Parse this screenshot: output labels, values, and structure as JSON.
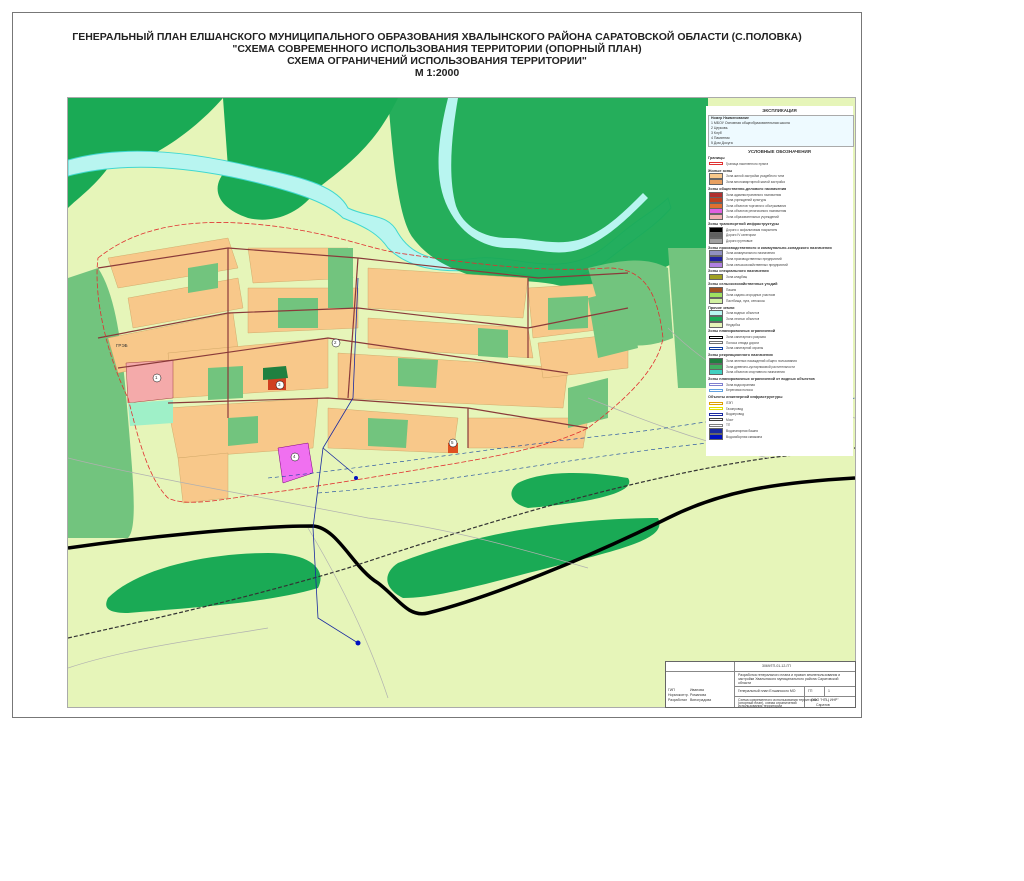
{
  "title": {
    "line1": "ГЕНЕРАЛЬНЫЙ ПЛАН ЕЛШАНСКОГО МУНИЦИПАЛЬНОГО ОБРАЗОВАНИЯ  ХВАЛЫНСКОГО РАЙОНА САРАТОВСКОЙ ОБЛАСТИ (С.ПОЛОВКА)",
    "line2": "\"СХЕМА СОВРЕМЕННОГО ИСПОЛЬЗОВАНИЯ ТЕРРИТОРИИ (ОПОРНЫЙ ПЛАН)",
    "line3": "СХЕМА ОГРАНИЧЕНИЙ ИСПОЛЬЗОВАНИЯ ТЕРРИТОРИИ\"",
    "line4": "М 1:2000"
  },
  "colors": {
    "background": "#e6f5b9",
    "forest": "#1aaa55",
    "green_area": "#72c47e",
    "residential": "#f8c88a",
    "river": "#b8f5f0",
    "road_main": "#000000",
    "road_street": "#8a3a3a",
    "utility": "#1a2aa0",
    "boundary": "#e03030"
  },
  "map": {
    "place_label": "ГРЭБ",
    "markers": [
      "1",
      "2",
      "3",
      "4",
      "5"
    ]
  },
  "legend": {
    "explication_title": "ЭКСПЛИКАЦИЯ",
    "explication_header": "Номер   Наименование",
    "explication_rows": [
      "1  МБОУ Основная общеобразовательная школа",
      "2  Церковь",
      "3  Клуб",
      "4  Памятник",
      "5  Дом Досуга"
    ],
    "symbols_title": "УСЛОВНЫЕ ОБОЗНАЧЕНИЯ",
    "sections": [
      {
        "name": "Границы",
        "items": [
          {
            "label": "Граница населенного пункта",
            "color": "#ffffff",
            "line": "#e03030"
          }
        ]
      },
      {
        "name": "Жилые зоны",
        "items": [
          {
            "label": "Зона жилой застройки усадебного типа",
            "color": "#f8c88a"
          },
          {
            "label": "Зона многоквартирной жилой застройки",
            "color": "#e8a060"
          }
        ]
      },
      {
        "name": "Зоны общественно-делового назначения",
        "items": [
          {
            "label": "Зона административного назначения",
            "color": "#b03030"
          },
          {
            "label": "Зона учреждений культуры",
            "color": "#c04020"
          },
          {
            "label": "Зона объектов торговли и обслуживания",
            "color": "#e07030"
          },
          {
            "label": "Зона объектов религиозного назначения",
            "color": "#e060e0"
          },
          {
            "label": "Зона образовательных учреждений",
            "color": "#f0b0b0"
          }
        ]
      },
      {
        "name": "Зоны транспортной инфраструктуры",
        "items": [
          {
            "label": "Дороги с асфальтовым покрытием",
            "color": "#000000"
          },
          {
            "label": "Дороги IV категории",
            "color": "#606060"
          },
          {
            "label": "Дороги грунтовые",
            "color": "#a0a0a0"
          }
        ]
      },
      {
        "name": "Зоны производственного и коммунально-складского назначения",
        "items": [
          {
            "label": "Зона коммунального назначения",
            "color": "#9090c0"
          },
          {
            "label": "Зона производственных предприятий",
            "color": "#2020a0"
          },
          {
            "label": "Зона сельскохозяйственных предприятий",
            "color": "#b080e0"
          }
        ]
      },
      {
        "name": "Зоны специального назначения",
        "items": [
          {
            "label": "Зона кладбищ",
            "color": "#a0a020"
          }
        ]
      },
      {
        "name": "Зоны сельскохозяйственных угодий",
        "items": [
          {
            "label": "Пашня",
            "color": "#a05020"
          },
          {
            "label": "Зона садово-огородных участков",
            "color": "#a0e060"
          },
          {
            "label": "Пастбища, луга, сенокосы",
            "color": "#d0f0a0"
          }
        ]
      },
      {
        "name": "Прочие земли",
        "items": [
          {
            "label": "Зона водных объектов",
            "color": "#b8f5f0"
          },
          {
            "label": "Зона лесных объектов",
            "color": "#1aaa55"
          },
          {
            "label": "Неудобья",
            "color": "#e6f5b9"
          }
        ]
      },
      {
        "name": "Зоны планировочных ограничений",
        "items": [
          {
            "label": "Зона санитарного разрыва",
            "color": "#ffffff",
            "line": "#000000"
          },
          {
            "label": "Полоса отвода дороги",
            "color": "#ffffff",
            "line": "#707070"
          },
          {
            "label": "Зона санитарной охраны",
            "color": "#ffffff",
            "line": "#1040a0"
          }
        ]
      },
      {
        "name": "Зоны рекреационного назначения",
        "items": [
          {
            "label": "Зона зеленых насаждений общего пользования",
            "color": "#208040"
          },
          {
            "label": "Зона древесно-кустарниковой растительности",
            "color": "#40b060"
          },
          {
            "label": "Зона объектов спортивного назначения",
            "color": "#40d0c0"
          }
        ]
      },
      {
        "name": "Зоны планировочных ограничений от водных объектов",
        "items": [
          {
            "label": "Зона водоохранная",
            "color": "#ffffff",
            "line": "#8080d0"
          },
          {
            "label": "Береговая полоса",
            "color": "#ffffff",
            "line": "#60a0e0"
          }
        ]
      },
      {
        "name": "Объекты инженерной инфраструктуры",
        "items": [
          {
            "label": "ЛЭП",
            "color": "#ffffff",
            "line": "#e0a000"
          },
          {
            "label": "Газопровод",
            "color": "#ffffff",
            "line": "#e0e000"
          },
          {
            "label": "Водопровод",
            "color": "#ffffff",
            "line": "#1a2aa0"
          },
          {
            "label": "Мост",
            "color": "#ffffff",
            "line": "#404040"
          },
          {
            "label": "ТП",
            "color": "#ffffff",
            "line": "#808080"
          },
          {
            "label": "Водонапорная башня",
            "color": "#1a2aa0"
          },
          {
            "label": "Водозаборная скважина",
            "color": "#0010c0"
          }
        ]
      }
    ]
  },
  "stamp": {
    "code": "3069/ГП-01-12-ГП",
    "desc1": "Разработка генерального плана и правил землепользования и",
    "desc2": "застройки Хвалынского муниципального района Саратовской",
    "desc3": "области",
    "plan_name": "Генеральный план Елшанского МО",
    "stage": "ГП",
    "sheet": "1",
    "sheets": "1",
    "desc4": "Схема современного использования территории",
    "desc5": "(опорный план), схема ограничений",
    "desc6": "использования территории",
    "company": "ООО \"НПЦ ИНР\"",
    "city": "Саратов",
    "roles": [
      "ГИП",
      "Нормоконтр.",
      "Разработал"
    ],
    "names": [
      "Иванова",
      "Романова",
      "Виноградова"
    ]
  }
}
